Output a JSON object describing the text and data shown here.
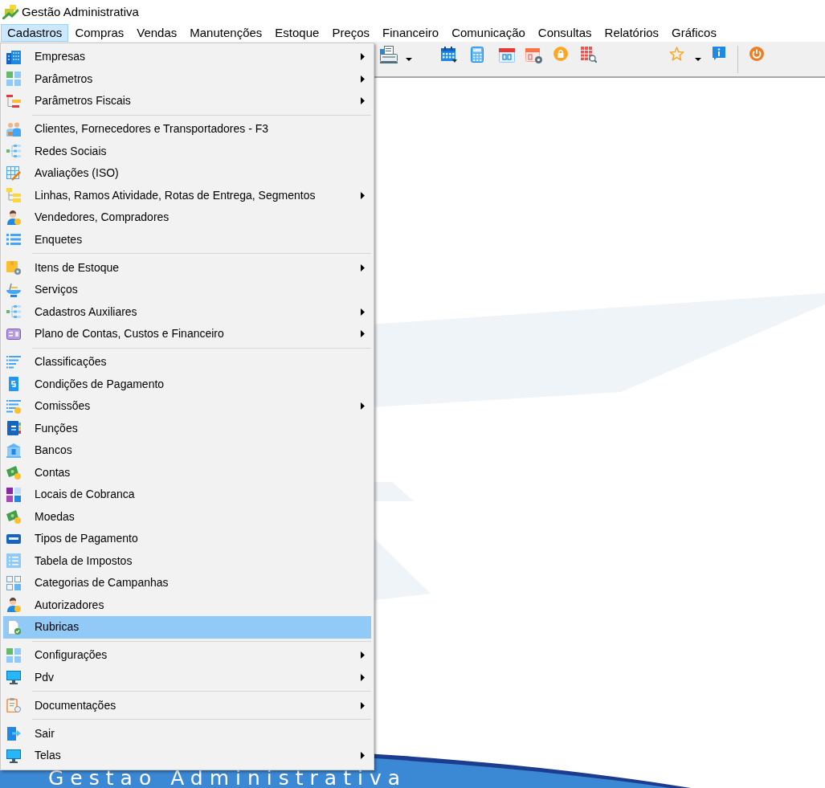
{
  "window": {
    "title": "Gestão Administrativa"
  },
  "menu_bar": [
    {
      "label": "Cadastros",
      "selected": true
    },
    {
      "label": "Compras",
      "selected": false
    },
    {
      "label": "Vendas",
      "selected": false
    },
    {
      "label": "Manutenções",
      "selected": false
    },
    {
      "label": "Estoque",
      "selected": false
    },
    {
      "label": "Preços",
      "selected": false
    },
    {
      "label": "Financeiro",
      "selected": false
    },
    {
      "label": "Comunicação",
      "selected": false
    },
    {
      "label": "Consultas",
      "selected": false
    },
    {
      "label": "Relatórios",
      "selected": false
    },
    {
      "label": "Gráficos",
      "selected": false
    }
  ],
  "dropdown_menu": {
    "groups": [
      {
        "items": [
          {
            "label": "Empresas",
            "has_submenu": true,
            "selected": false
          },
          {
            "label": "Parâmetros",
            "has_submenu": true,
            "selected": false
          },
          {
            "label": "Parâmetros Fiscais",
            "has_submenu": true,
            "selected": false
          }
        ]
      },
      {
        "items": [
          {
            "label": "Clientes, Fornecedores e Transportadores - F3",
            "has_submenu": false,
            "selected": false
          },
          {
            "label": "Redes Sociais",
            "has_submenu": false,
            "selected": false
          },
          {
            "label": "Avaliações (ISO)",
            "has_submenu": false,
            "selected": false
          },
          {
            "label": "Linhas, Ramos Atividade, Rotas de Entrega, Segmentos",
            "has_submenu": true,
            "selected": false
          },
          {
            "label": "Vendedores, Compradores",
            "has_submenu": false,
            "selected": false
          },
          {
            "label": "Enquetes",
            "has_submenu": false,
            "selected": false
          }
        ]
      },
      {
        "items": [
          {
            "label": "Itens de Estoque",
            "has_submenu": true,
            "selected": false
          },
          {
            "label": "Serviços",
            "has_submenu": false,
            "selected": false
          },
          {
            "label": "Cadastros Auxiliares",
            "has_submenu": true,
            "selected": false
          },
          {
            "label": "Plano de Contas, Custos e Financeiro",
            "has_submenu": true,
            "selected": false
          }
        ]
      },
      {
        "items": [
          {
            "label": "Classificações",
            "has_submenu": false,
            "selected": false
          },
          {
            "label": "Condições de Pagamento",
            "has_submenu": false,
            "selected": false
          },
          {
            "label": "Comissões",
            "has_submenu": true,
            "selected": false
          },
          {
            "label": "Funções",
            "has_submenu": false,
            "selected": false
          },
          {
            "label": "Bancos",
            "has_submenu": false,
            "selected": false
          },
          {
            "label": "Contas",
            "has_submenu": false,
            "selected": false
          },
          {
            "label": "Locais de Cobranca",
            "has_submenu": false,
            "selected": false
          },
          {
            "label": "Moedas",
            "has_submenu": false,
            "selected": false
          },
          {
            "label": "Tipos de Pagamento",
            "has_submenu": false,
            "selected": false
          },
          {
            "label": "Tabela de Impostos",
            "has_submenu": false,
            "selected": false
          },
          {
            "label": "Categorias de Campanhas",
            "has_submenu": false,
            "selected": false
          },
          {
            "label": "Autorizadores",
            "has_submenu": false,
            "selected": false
          },
          {
            "label": "Rubricas",
            "has_submenu": false,
            "selected": true
          }
        ]
      },
      {
        "items": [
          {
            "label": "Configurações",
            "has_submenu": true,
            "selected": false
          },
          {
            "label": "Pdv",
            "has_submenu": true,
            "selected": false
          }
        ]
      },
      {
        "items": [
          {
            "label": "Documentações",
            "has_submenu": true,
            "selected": false
          }
        ]
      },
      {
        "items": [
          {
            "label": "Sair",
            "has_submenu": false,
            "selected": false
          },
          {
            "label": "Telas",
            "has_submenu": true,
            "selected": false
          }
        ]
      }
    ]
  },
  "background_banner": {
    "text": "Gestao Administrativa"
  }
}
